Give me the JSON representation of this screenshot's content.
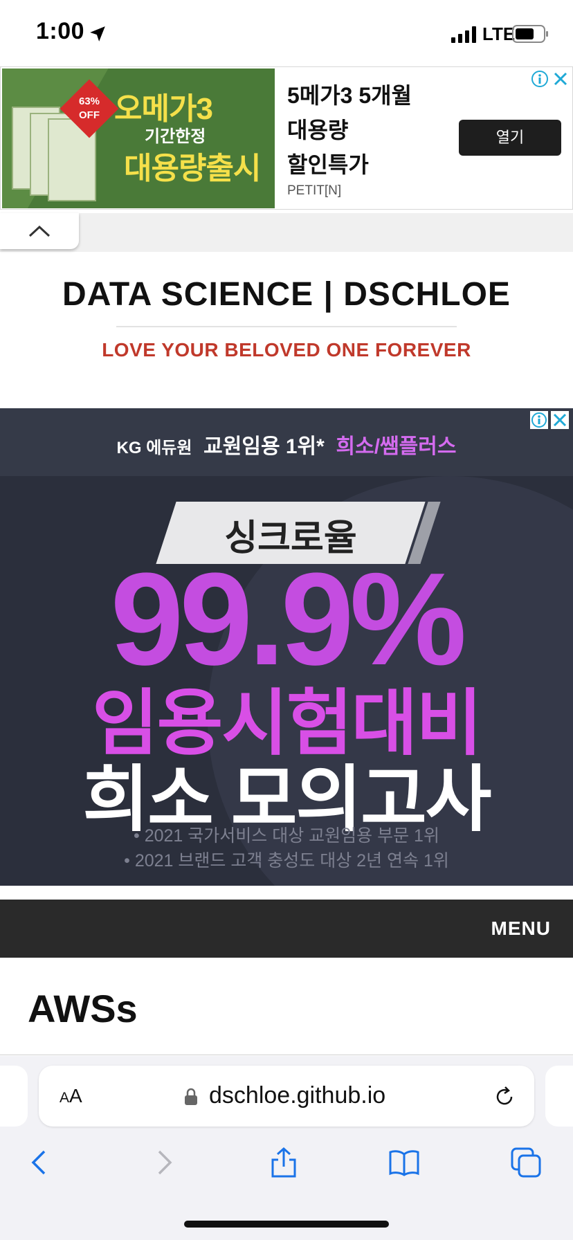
{
  "status_bar": {
    "time": "1:00",
    "network": "LTE",
    "location_icon": "location-arrow-icon",
    "signal_icon": "cellular-signal-icon",
    "battery_icon": "battery-icon"
  },
  "top_ad": {
    "image_badge": "63% OFF",
    "image_headline_1": "오메가3",
    "image_headline_2": "기간한정",
    "image_headline_3": "대용량출시",
    "text_line_1": "5메가3 5개월",
    "text_line_2": "대용량",
    "text_line_3": "할인특가",
    "brand": "PETIT[N]",
    "open_button": "열기",
    "adchoices_icon": "adchoices-icon",
    "close_icon": "close-icon"
  },
  "site": {
    "title": "DATA SCIENCE | DSCHLOE",
    "tagline": "LOVE YOUR BELOVED ONE FOREVER",
    "tagline_color": "#c0392b"
  },
  "big_ad": {
    "sponsor_prefix": "KG 에듀원",
    "sponsor_main": "교원임용 1위*",
    "sponsor_accent": "희소/쌤플러스",
    "sync_label": "싱크로율",
    "percent": "99.9%",
    "line_1": "임용시험대비",
    "line_2": "희소 모의고사",
    "note_1": "• 2021 국가서비스 대상 교원임용 부문 1위",
    "note_2": "• 2021 브랜드 고객 충성도 대상 2년 연속 1위",
    "accent_color": "#d84fe6"
  },
  "nav": {
    "menu_label": "MENU"
  },
  "post": {
    "title": "AWSs"
  },
  "browser": {
    "text_size_label_small": "A",
    "text_size_label_large": "A",
    "url": "dschloe.github.io",
    "lock_icon": "lock-icon",
    "reload_icon": "reload-icon",
    "toolbar": [
      "back-icon",
      "forward-icon",
      "share-icon",
      "bookmarks-icon",
      "tabs-icon"
    ]
  }
}
